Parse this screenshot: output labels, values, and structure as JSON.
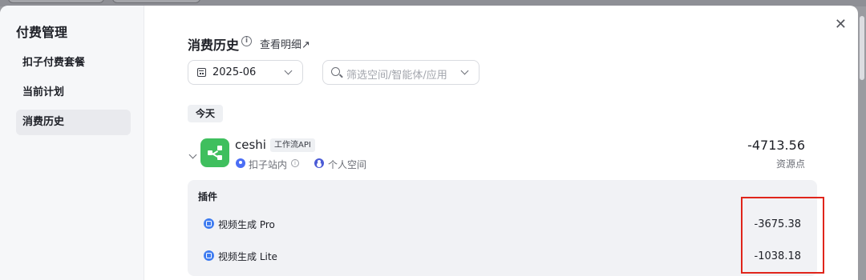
{
  "sidebar": {
    "title": "付费管理",
    "items": [
      {
        "label": "扣子付费套餐",
        "active": false
      },
      {
        "label": "当前计划",
        "active": false
      },
      {
        "label": "消费历史",
        "active": true
      }
    ]
  },
  "header": {
    "title": "消费历史",
    "detail_link": "查看明细↗"
  },
  "filters": {
    "date_value": "2025-06",
    "scope_placeholder": "筛选空间/智能体/应用"
  },
  "day_group": {
    "label": "今天"
  },
  "record": {
    "name": "ceshi",
    "tag": "工作流API",
    "source": "扣子站内",
    "space": "个人空间",
    "total": "-4713.56",
    "unit": "资源点",
    "app_icon_color": "#3fbf5e"
  },
  "plugins": {
    "title": "插件",
    "rows": [
      {
        "label": "视频生成 Pro",
        "amount": "-3675.38"
      },
      {
        "label": "视频生成 Lite",
        "amount": "-1038.18"
      }
    ]
  },
  "colors": {
    "highlight": "#e0251b",
    "accent": "#4b6ef5"
  }
}
